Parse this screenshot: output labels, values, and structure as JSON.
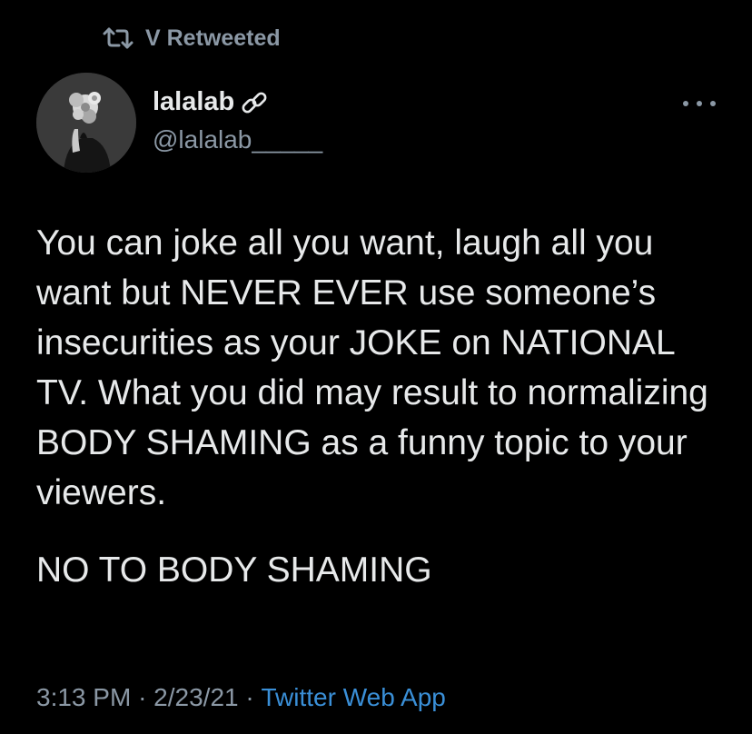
{
  "retweet": {
    "label": "V Retweeted",
    "icon": "retweet-icon"
  },
  "author": {
    "name": "lalalab",
    "handle": "@lalalab_____",
    "badge_icon": "link-icon",
    "avatar": "avatar-flower-portrait"
  },
  "more_icon": "more-options-icon",
  "tweet": {
    "paragraphs": [
      "You can joke all you want, laugh all you want but NEVER EVER use someone’s insecurities as your JOKE on NATIONAL TV. What you did may result to normalizing BODY SHAMING as a funny topic to your viewers.",
      "NO TO BODY SHAMING"
    ]
  },
  "meta": {
    "time": "3:13 PM",
    "separator": "·",
    "date": "2/23/21",
    "source": "Twitter Web App"
  },
  "colors": {
    "background": "#000000",
    "text": "#e7e9ea",
    "secondary": "#8b98a5",
    "link": "#3a8fd7"
  }
}
